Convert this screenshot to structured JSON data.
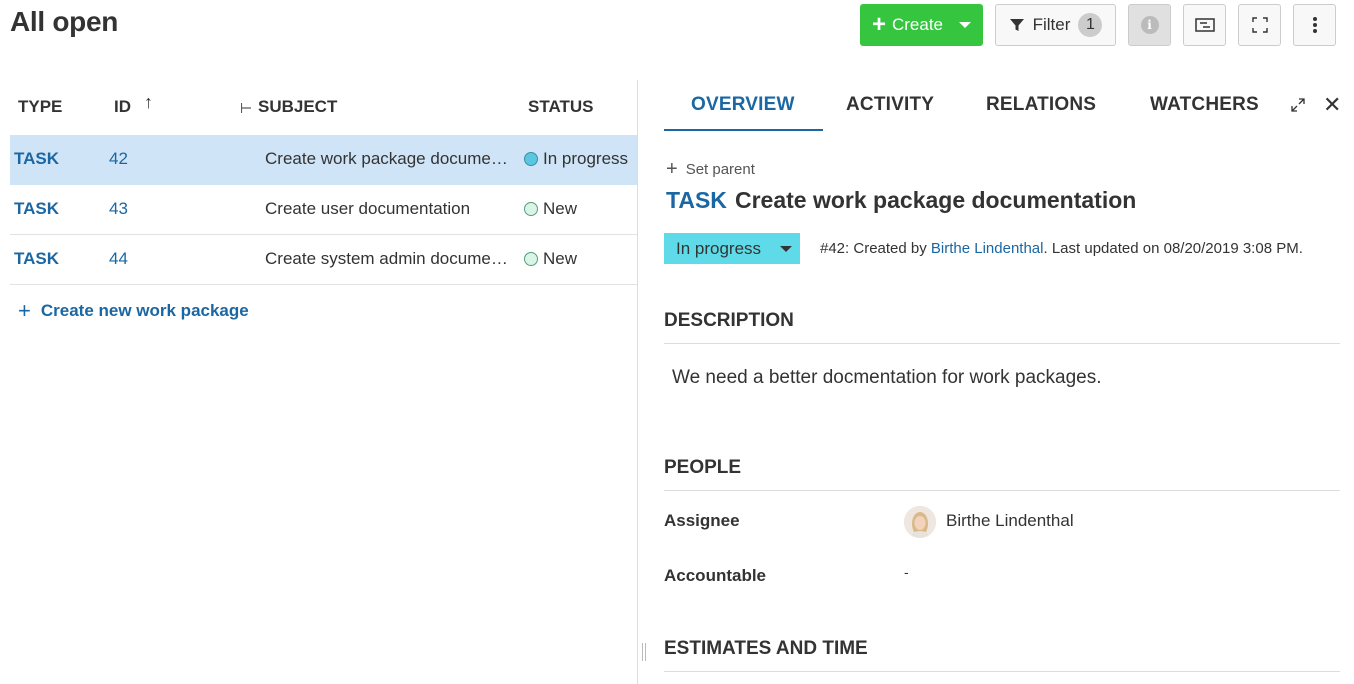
{
  "header": {
    "title": "All open",
    "create_label": "Create",
    "filter_label": "Filter",
    "filter_count": "1"
  },
  "table": {
    "columns": [
      "TYPE",
      "ID",
      "SUBJECT",
      "STATUS"
    ],
    "rows": [
      {
        "type": "TASK",
        "id": "42",
        "subject": "Create work package documentation",
        "status": "In progress"
      },
      {
        "type": "TASK",
        "id": "43",
        "subject": "Create user documentation",
        "status": "New"
      },
      {
        "type": "TASK",
        "id": "44",
        "subject": "Create system admin documentation",
        "status": "New"
      }
    ],
    "create_link": "Create new work package"
  },
  "details": {
    "tabs": [
      "OVERVIEW",
      "ACTIVITY",
      "RELATIONS",
      "WATCHERS"
    ],
    "set_parent": "Set parent",
    "type": "TASK",
    "subject": "Create work package documentation",
    "status": "In progress",
    "meta_prefix": "#42: Created by ",
    "meta_author": "Birthe Lindenthal",
    "meta_suffix": ". Last updated on 08/20/2019 3:08 PM.",
    "description_title": "DESCRIPTION",
    "description": "We need a better docmentation for work packages.",
    "people_title": "PEOPLE",
    "assignee_label": "Assignee",
    "assignee_value": "Birthe Lindenthal",
    "accountable_label": "Accountable",
    "accountable_value": "-",
    "estimates_title": "ESTIMATES AND TIME"
  },
  "colors": {
    "accent": "#1a67a3",
    "create": "#35c53f",
    "in_progress": "#5fdae8",
    "selected_row": "#cfe5f7"
  }
}
